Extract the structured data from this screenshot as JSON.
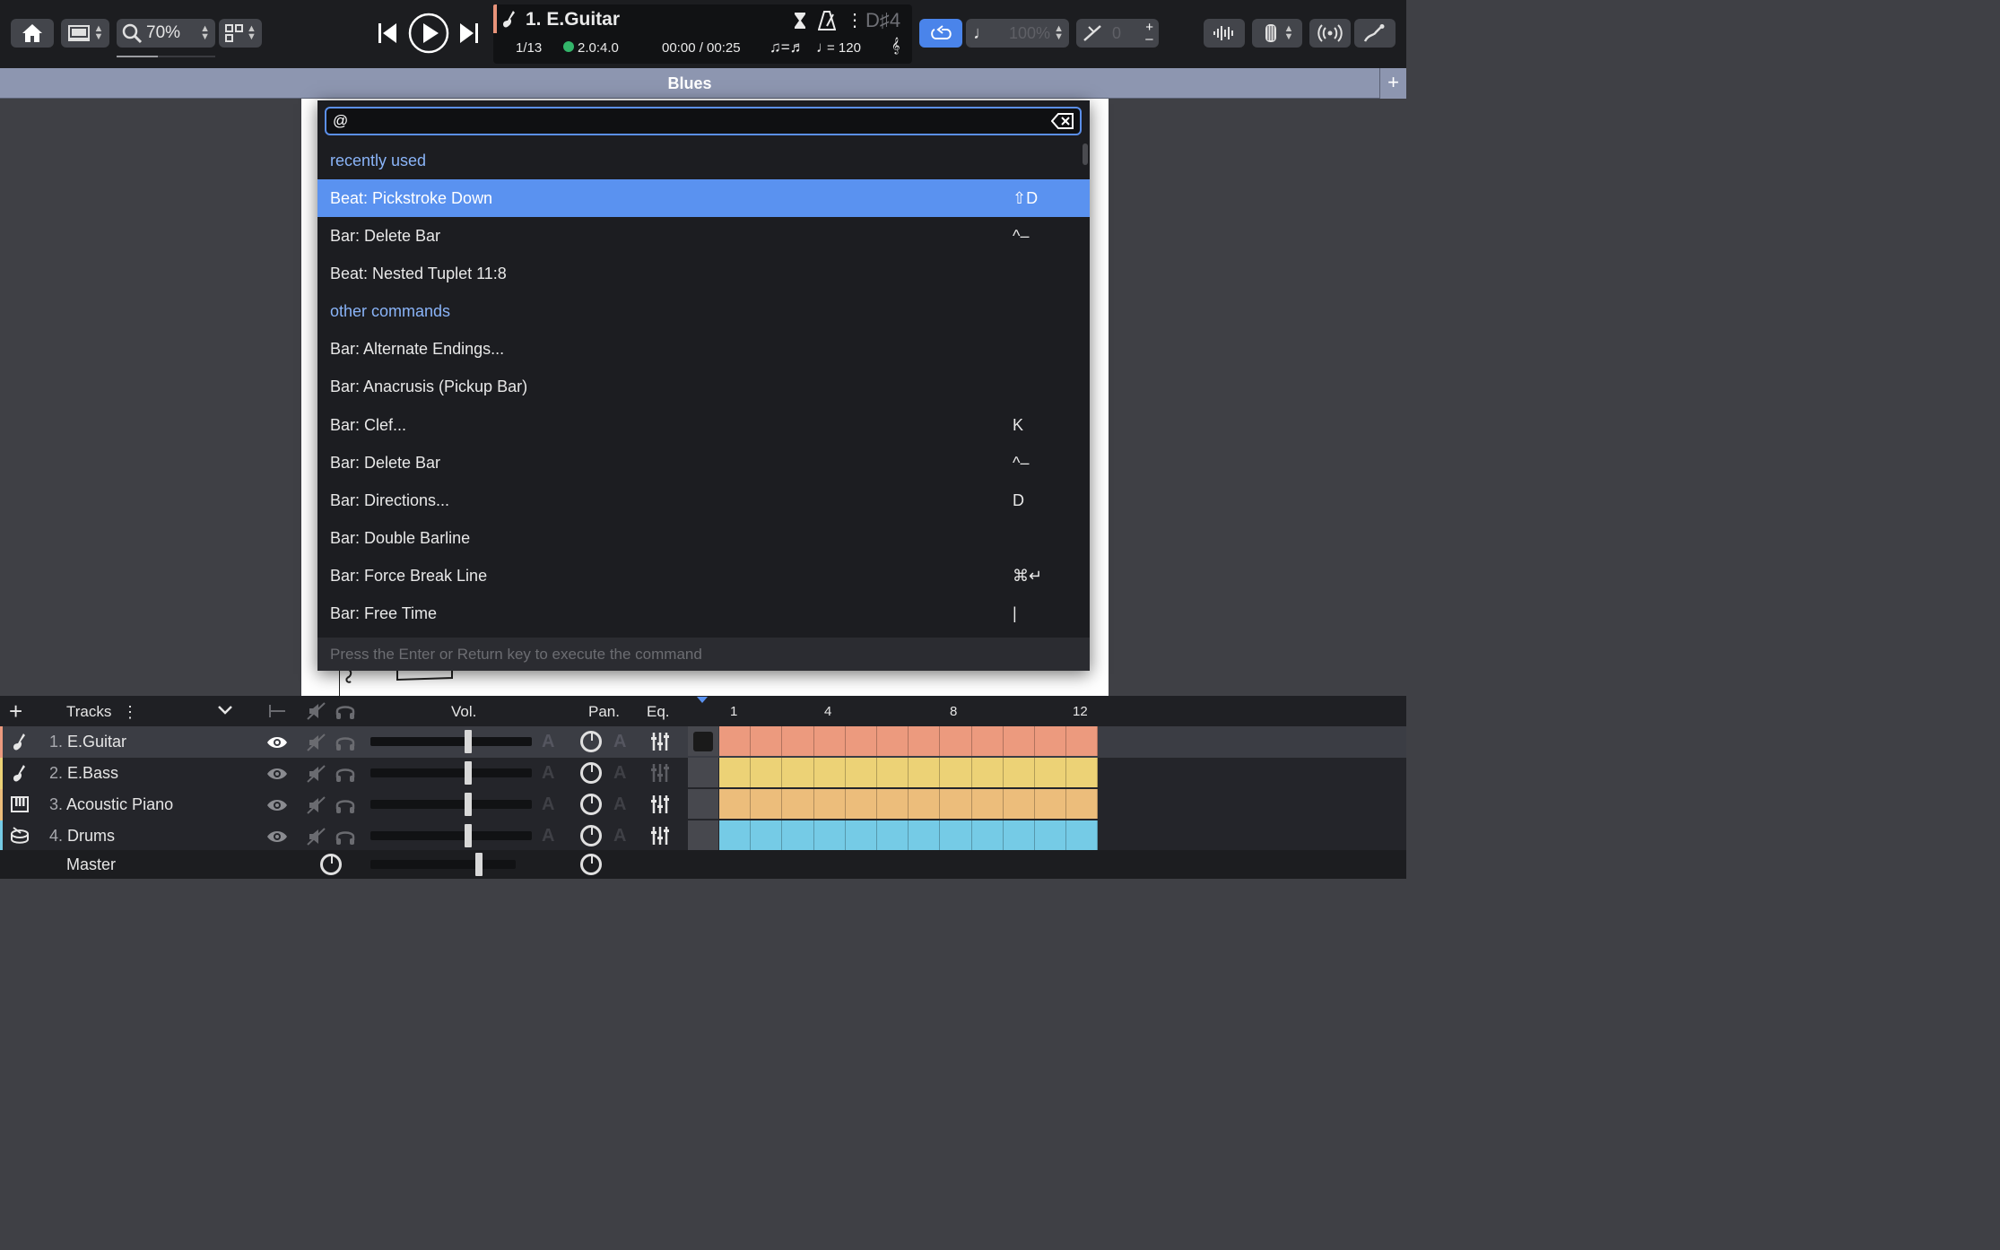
{
  "toolbar": {
    "zoom_value": "70%",
    "zoom_progress": 0.42,
    "track_title": "1. E.Guitar",
    "bar_position": "1/13",
    "beat_position": "2.0:4.0",
    "time": "00:00 / 00:25",
    "key_signature": "D♯4",
    "tempo": "= 120",
    "speed": "100%",
    "transpose": "0",
    "swing": "=",
    "colors": {
      "accent": "#4a84ea",
      "track_accent": "#e8937a",
      "status_green": "#33b56a"
    }
  },
  "title_bar": {
    "title": "Blues",
    "add_label": "+"
  },
  "palette": {
    "input_value": "@",
    "items": [
      {
        "type": "header",
        "label": "recently used",
        "shortcut": ""
      },
      {
        "type": "command",
        "label": "Beat: Pickstroke Down",
        "shortcut": "⇧D",
        "selected": true
      },
      {
        "type": "command",
        "label": "Bar: Delete Bar",
        "shortcut": "^–"
      },
      {
        "type": "command",
        "label": "Beat: Nested Tuplet 11:8",
        "shortcut": ""
      },
      {
        "type": "header",
        "label": "other commands",
        "shortcut": ""
      },
      {
        "type": "command",
        "label": "Bar: Alternate Endings...",
        "shortcut": ""
      },
      {
        "type": "command",
        "label": "Bar: Anacrusis (Pickup Bar)",
        "shortcut": ""
      },
      {
        "type": "command",
        "label": "Bar: Clef...",
        "shortcut": "K"
      },
      {
        "type": "command",
        "label": "Bar: Delete Bar",
        "shortcut": "^–"
      },
      {
        "type": "command",
        "label": "Bar: Directions...",
        "shortcut": "D"
      },
      {
        "type": "command",
        "label": "Bar: Double Barline",
        "shortcut": ""
      },
      {
        "type": "command",
        "label": "Bar: Force Break Line",
        "shortcut": "⌘↵"
      },
      {
        "type": "command",
        "label": "Bar: Free Time",
        "shortcut": "|"
      }
    ],
    "footer": "Press the Enter or Return key to execute the command"
  },
  "tracks_panel": {
    "header": {
      "add": "+",
      "label": "Tracks",
      "vol": "Vol.",
      "pan": "Pan.",
      "eq": "Eq."
    },
    "ruler": [
      "1",
      "4",
      "8",
      "12"
    ],
    "tracks": [
      {
        "num": "1.",
        "name": "E.Guitar",
        "color": "#ec9a7e",
        "icon": "guitar-icon"
      },
      {
        "num": "2.",
        "name": "E.Bass",
        "color": "#ecd276",
        "icon": "bass-icon"
      },
      {
        "num": "3.",
        "name": "Acoustic Piano",
        "color": "#ecbd7b",
        "icon": "piano-icon"
      },
      {
        "num": "4.",
        "name": "Drums",
        "color": "#75cbe6",
        "icon": "drums-icon"
      }
    ],
    "master": "Master"
  }
}
